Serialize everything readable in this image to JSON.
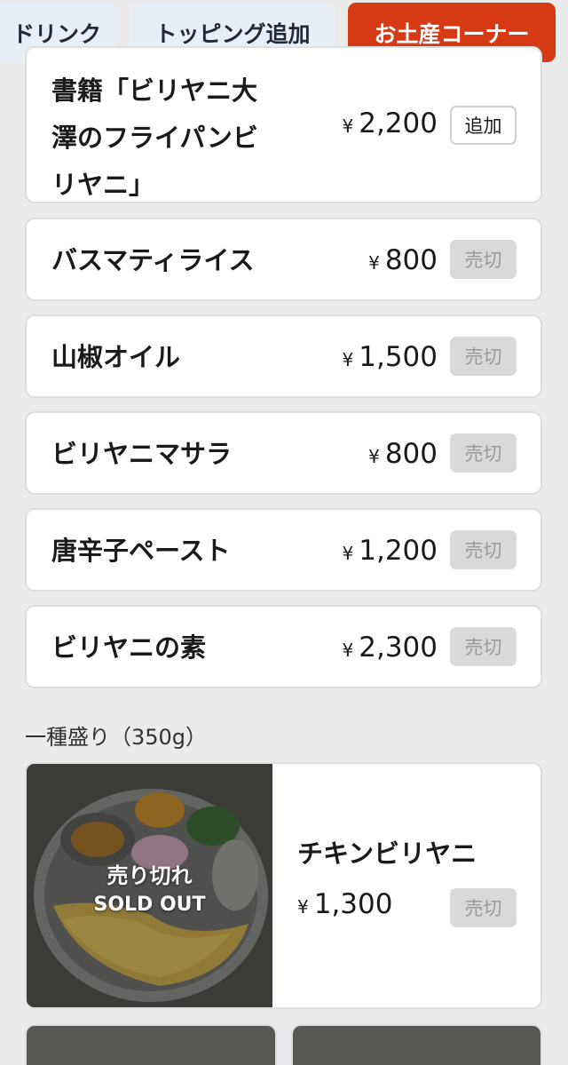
{
  "tabs": [
    {
      "label": "ドリンク"
    },
    {
      "label": "トッピング追加"
    },
    {
      "label": "お土産コーナー",
      "active": true
    }
  ],
  "items": [
    {
      "name_lines": [
        "書籍「ビリヤニ大",
        "澤のフライパンビ",
        "リヤニ」"
      ],
      "yen": "¥",
      "price": "2,200",
      "button": "追加"
    },
    {
      "name": "バスマティライス",
      "yen": "¥",
      "price": "800",
      "button": "売切"
    },
    {
      "name": "山椒オイル",
      "yen": "¥",
      "price": "1,500",
      "button": "売切"
    },
    {
      "name": "ビリヤニマサラ",
      "yen": "¥",
      "price": "800",
      "button": "売切"
    },
    {
      "name": "唐辛子ペースト",
      "yen": "¥",
      "price": "1,200",
      "button": "売切"
    },
    {
      "name": "ビリヤニの素",
      "yen": "¥",
      "price": "2,300",
      "button": "売切"
    }
  ],
  "section": {
    "label": "一種盛り（350g）"
  },
  "card": {
    "overlay_jp": "売り切れ",
    "overlay_en": "SOLD OUT",
    "name": "チキンビリヤニ",
    "yen": "¥",
    "price": "1,300",
    "button": "売切"
  },
  "colors": {
    "accent": "#d63a14",
    "tab_bg": "#e8eef6",
    "sold_bg": "#d9d9d9",
    "page_bg": "#ebebeb"
  }
}
